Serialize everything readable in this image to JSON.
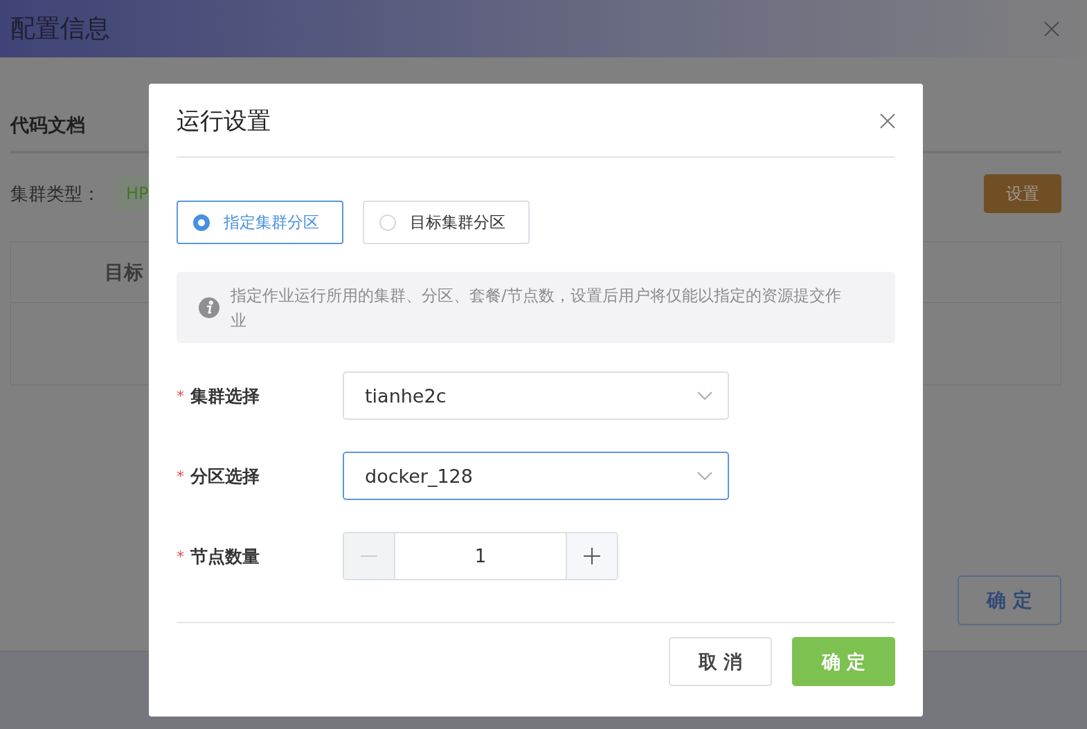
{
  "page": {
    "title": "配置信息",
    "tabs": [
      {
        "label": "代码文档",
        "selected": true
      }
    ],
    "cluster_type_label": "集群类型：",
    "cluster_type_tag": "HP",
    "settings_button": "设置",
    "table": {
      "columns": [
        "目标"
      ]
    },
    "confirm_button": "确 定"
  },
  "dialog": {
    "title": "运行设置",
    "modes": [
      {
        "label": "指定集群分区",
        "selected": true
      },
      {
        "label": "目标集群分区",
        "selected": false
      }
    ],
    "info": "指定作业运行所用的集群、分区、套餐/节点数，设置后用户将仅能以指定的资源提交作业",
    "fields": [
      {
        "kind": "select",
        "asterisk": "*",
        "label": "集群选择",
        "value": "tianhe2c",
        "focused": false
      },
      {
        "kind": "select",
        "asterisk": "*",
        "label": "分区选择",
        "value": "docker_128",
        "focused": true
      },
      {
        "kind": "number",
        "asterisk": "*",
        "label": "节点数量",
        "value": "1",
        "minus_disabled": true
      }
    ],
    "buttons": [
      {
        "label": "取 消",
        "kind": "default"
      },
      {
        "label": "确 定",
        "kind": "primary"
      }
    ]
  }
}
